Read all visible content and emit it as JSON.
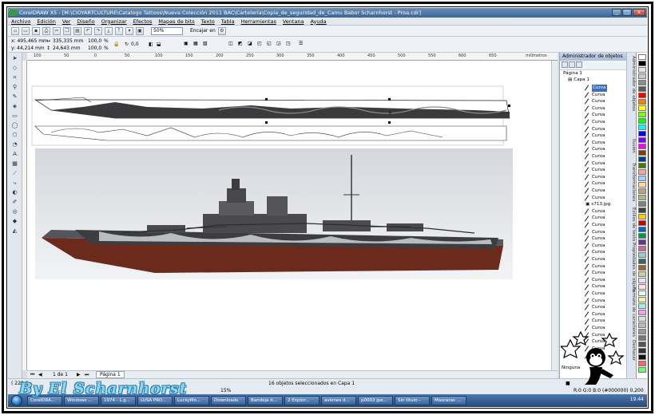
{
  "window": {
    "title": "CorelDRAW X5 - [M:\\CIOYARTCULTURE\\Catalogo Tattoos\\Nueva Colección 2011 BAC\\Cartelería\\Copia_de_seguridad_de_Camu Babor Scharnhorst - Proa.cdr]",
    "controls": [
      "_",
      "□",
      "x"
    ]
  },
  "menu": [
    "Archivo",
    "Edición",
    "Ver",
    "Diseño",
    "Organizar",
    "Efectos",
    "Mapas de bits",
    "Texto",
    "Tabla",
    "Herramientas",
    "Ventana",
    "Ayuda"
  ],
  "toolbar": {
    "zoom": "50%",
    "snap": "Encajar en"
  },
  "propbar": {
    "x": "x: 495,465 mm",
    "y": "y: 44,214 mm",
    "w": "335,335 mm",
    "h": "24,643 mm",
    "scale_w": "100,0",
    "scale_h": "100,0",
    "pct": "%",
    "angle": "0,0"
  },
  "ruler": {
    "ticks": [
      "100",
      "50",
      "0",
      "50",
      "100",
      "150",
      "200",
      "250",
      "300",
      "350",
      "400",
      "450",
      "500",
      "550",
      "600",
      "650"
    ],
    "unit": "milímetros"
  },
  "docker": {
    "title": "Administrador de objetos",
    "page": "Página 1",
    "layer": "Capa 1",
    "selected_item": "Curva",
    "item_label": "Curva",
    "bitmap_label": "s713.jpg",
    "bitmap_index": 17,
    "item_count": 40,
    "footer": "Ninguna",
    "fill_readout": "R:0 G:0 B:0 (#000000)  0,200 mm"
  },
  "sidetabs": [
    "Administrador de objetos",
    "Ilusión",
    "Transformaciones",
    "Estilos de texto",
    "Propiedades de objeto",
    "Formato de caracteres",
    "Deshacer"
  ],
  "pages": {
    "position": "1 de 1",
    "tab": "Página 1"
  },
  "status": {
    "coords": "( 228,6...",
    "objects": "16 objetos seleccionados en Capa 1",
    "zoom_hint": "15%"
  },
  "watermark": "By El Scharnhorst",
  "taskbar": {
    "tasks": [
      "CorelDRA...",
      "Windows ...",
      "1974 - L.g...",
      "LUSA PRO...",
      "LuckyMo...",
      "Downloads",
      "Bandeja d...",
      "2 Explor...",
      "aviones d...",
      "p0003 jpe...",
      "Sin título -",
      "Mascaras ..."
    ],
    "clock": "19:44"
  },
  "colors": {
    "accent": "#3a6fc4",
    "hull_red": "#6b2a1c",
    "camo_dark": "#3d3d40",
    "camo_light": "#b9bcc0",
    "taskbar": "#24477a"
  },
  "palette": [
    "#ffffff",
    "#000000",
    "#e4e4e4",
    "#c9c9c9",
    "#8f8f8f",
    "#5b5b5b",
    "#ff0000",
    "#ff7f00",
    "#ffff00",
    "#7fff00",
    "#00ff00",
    "#00ffff",
    "#0000ff",
    "#7f00ff",
    "#ff00ff",
    "#7f3f00",
    "#003f7f",
    "#3f7f00",
    "#ff9f9f",
    "#9fcfff",
    "#ffd9a0",
    "#c0a080",
    "#a0c080",
    "#808080",
    "#404040",
    "#ffcc00",
    "#cc0000",
    "#0066cc",
    "#00994c",
    "#663399",
    "#cc6699",
    "#99cccc",
    "#336666",
    "#996633",
    "#cccc99",
    "#e0e0ff",
    "#ffe0e0",
    "#e0ffe0",
    "#f0f0a0",
    "#a0f0f0",
    "#f0a0f0",
    "#dddddd",
    "#bbbbbb",
    "#999999",
    "#777777",
    "#555555",
    "#333333",
    "#111111",
    "#ff6666",
    "#66ff66"
  ]
}
